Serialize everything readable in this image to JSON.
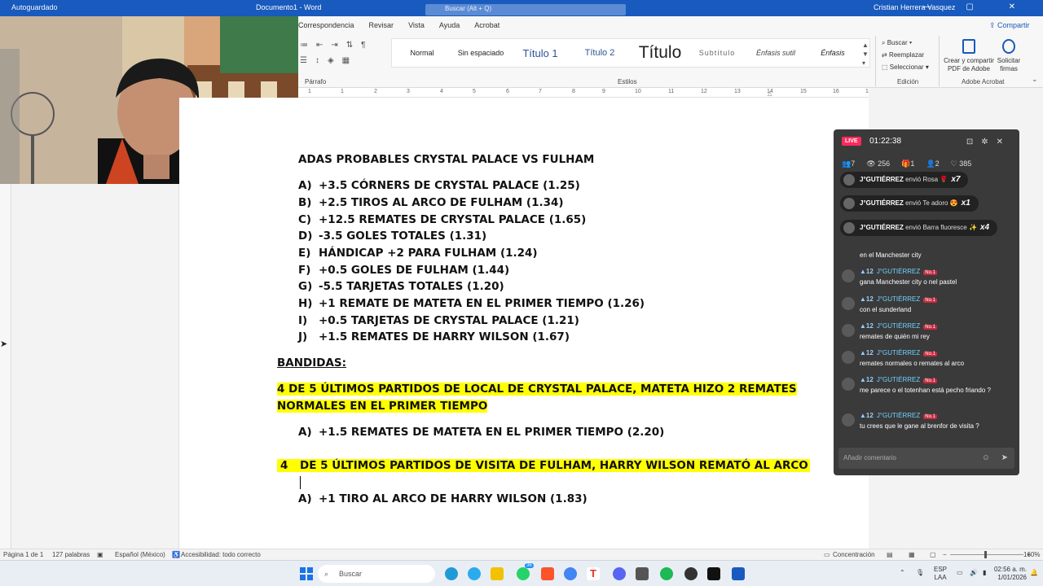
{
  "titlebar": {
    "autosave": "Autoguardado",
    "doc_name": "Documento1 - Word",
    "search_placeholder": "Buscar (Alt + Q)",
    "user": "Cristian Herrera Vasquez",
    "window_controls": "— ▢ ✕"
  },
  "ribbon": {
    "tabs": [
      "Correspondencia",
      "Revisar",
      "Vista",
      "Ayuda",
      "Acrobat"
    ],
    "share": "Compartir",
    "paragraph_label": "Párrafo",
    "styles_label": "Estilos",
    "styles": [
      "Normal",
      "Sin espaciado",
      "Título 1",
      "Título 2",
      "Título",
      "Subtítulo",
      "Énfasis sutil",
      "Énfasis"
    ],
    "edit": {
      "find": "Buscar",
      "replace": "Reemplazar",
      "select": "Seleccionar",
      "label": "Edición"
    },
    "adobe": {
      "create": "Crear y compartir PDF de Adobe",
      "sign": "Solicitar firmas",
      "label": "Adobe Acrobat"
    }
  },
  "ruler": [
    "1",
    "1",
    "2",
    "3",
    "4",
    "5",
    "6",
    "7",
    "8",
    "9",
    "10",
    "11",
    "12",
    "13",
    "14",
    "15",
    "16",
    "17"
  ],
  "document": {
    "heading": "ADAS PROBABLES CRYSTAL PALACE VS FULHAM",
    "items": [
      {
        "letter": "A)",
        "text": "+3.5 CÓRNERS DE CRYSTAL PALACE (1.25)"
      },
      {
        "letter": "B)",
        "text": "+2.5 TIROS AL ARCO DE FULHAM (1.34)"
      },
      {
        "letter": "C)",
        "text": "+12.5 REMATES DE CRYSTAL PALACE (1.65)"
      },
      {
        "letter": "D)",
        "text": "-3.5 GOLES TOTALES (1.31)"
      },
      {
        "letter": "E)",
        "text": "HÁNDICAP +2 PARA FULHAM (1.24)"
      },
      {
        "letter": "F)",
        "text": "+0.5 GOLES DE FULHAM (1.44)"
      },
      {
        "letter": "G)",
        "text": "-5.5 TARJETAS TOTALES (1.20)"
      },
      {
        "letter": "H)",
        "text": "+1 REMATE DE MATETA EN EL PRIMER TIEMPO (1.26)"
      },
      {
        "letter": "I)",
        "text": "+0.5 TARJETAS DE CRYSTAL PALACE (1.21)"
      },
      {
        "letter": "J)",
        "text": "+1.5 REMATES DE HARRY WILSON (1.67)"
      }
    ],
    "bandidas": "BANDIDAS:",
    "hl1_line1": "4 DE 5 ÚLTIMOS PARTIDOS DE LOCAL DE CRYSTAL PALACE, MATETA HIZO 2 REMATES",
    "hl1_line2": "NORMALES EN EL PRIMER TIEMPO",
    "pick1": {
      "letter": "A)",
      "text": "+1.5 REMATES DE MATETA EN EL PRIMER TIEMPO (2.20)"
    },
    "hl2_num": "4",
    "hl2_text": "DE 5 ÚLTIMOS PARTIDOS DE VISITA DE FULHAM, HARRY WILSON REMATÓ AL ARCO",
    "pick2": {
      "letter": "A)",
      "text": "+1 TIRO AL ARCO DE HARRY WILSON (1.83)"
    }
  },
  "live": {
    "badge": "LIVE",
    "time": "01:22:38",
    "stats": [
      "7",
      "256",
      "1",
      "2",
      "385"
    ],
    "gifts": [
      {
        "user": "J°GUTIÉRREZ",
        "action": "envió Rosa",
        "count": "x7"
      },
      {
        "user": "J°GUTIÉRREZ",
        "action": "envió Te adoro",
        "count": "x1"
      },
      {
        "user": "J°GUTIÉRREZ",
        "action": "envió Barra fluoresce",
        "count": "x4"
      }
    ],
    "partial": "en el Manchester city",
    "messages": [
      {
        "level": "12",
        "user": "J°GUTIÉRREZ",
        "rank": "No.1",
        "text": "gana Manchester city o nel pastel"
      },
      {
        "level": "12",
        "user": "J°GUTIÉRREZ",
        "rank": "No.1",
        "text": "con el sunderland"
      },
      {
        "level": "12",
        "user": "J°GUTIÉRREZ",
        "rank": "No.1",
        "text": "remates de quién mi rey"
      },
      {
        "level": "12",
        "user": "J°GUTIÉRREZ",
        "rank": "No.1",
        "text": "remates normales o remates al arco"
      },
      {
        "level": "12",
        "user": "J°GUTIÉRREZ",
        "rank": "No.1",
        "text": "me parece o el totenhan está pecho friando ?"
      },
      {
        "level": "12",
        "user": "J°GUTIÉRREZ",
        "rank": "No.1",
        "text": "tu crees que le gane al brenfor de visita ?"
      }
    ],
    "comment_placeholder": "Añadir comentario"
  },
  "status": {
    "page": "Página 1 de 1",
    "words": "127 palabras",
    "lang": "Español (México)",
    "access": "Accesibilidad: todo correcto",
    "focus": "Concentración",
    "zoom": "160%"
  },
  "taskbar": {
    "search": "Buscar",
    "lang": "ESP",
    "lang2": "LAA",
    "time": "02:56 a. m.",
    "date": "1/01/2026",
    "whatsapp_badge": "36"
  }
}
